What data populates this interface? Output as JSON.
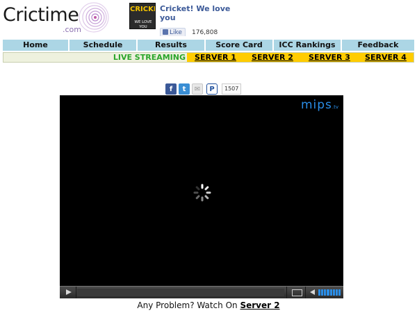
{
  "site": {
    "logo_word": "Crictime",
    "logo_suffix": ".com"
  },
  "fb_widget": {
    "page_title": "Cricket! We love you",
    "thumb_text_top": "CRICKET",
    "thumb_text_bottom": "WE LOVE YOU",
    "like_label": "Like",
    "like_count": "176,808"
  },
  "nav": {
    "items": [
      {
        "label": "Home"
      },
      {
        "label": "Schedule"
      },
      {
        "label": "Results"
      },
      {
        "label": "Score Card"
      },
      {
        "label": "ICC Rankings"
      },
      {
        "label": "Feedback"
      }
    ]
  },
  "streaming": {
    "label": "LIVE STREAMING",
    "servers": [
      {
        "label": "SERVER 1"
      },
      {
        "label": "SERVER 2"
      },
      {
        "label": "SERVER 3"
      },
      {
        "label": "SERVER 4"
      }
    ]
  },
  "share": {
    "facebook_glyph": "f",
    "twitter_glyph": "t",
    "mail_glyph": "✉",
    "pinterest_glyph": "P",
    "count": "1507"
  },
  "player": {
    "brand": "mips",
    "brand_suffix": ".tv",
    "state": "loading",
    "accent_color": "#2a8ee8"
  },
  "footer": {
    "prompt": "Any Problem? Watch On",
    "link_label": "Server 2"
  },
  "colors": {
    "nav_bg": "#acd6e5",
    "server_bg": "#ffcc00",
    "live_green": "#2aa52a",
    "fb_blue": "#3b5998"
  }
}
